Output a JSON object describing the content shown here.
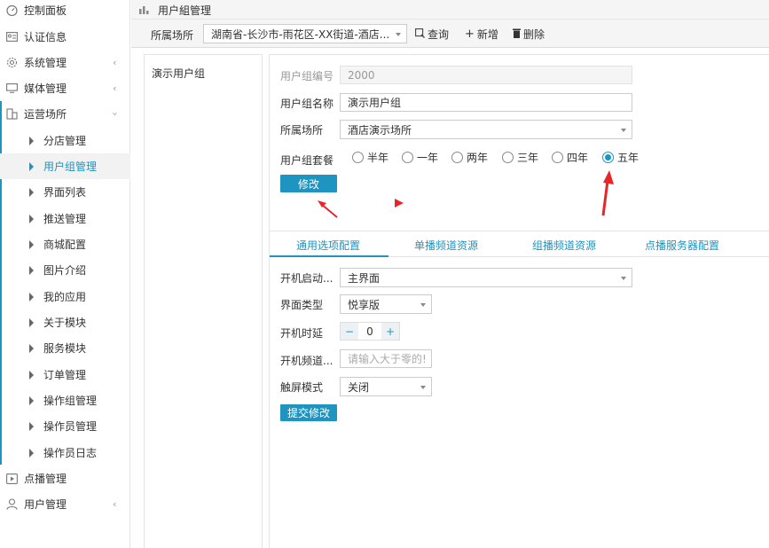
{
  "sidebar": {
    "items": [
      {
        "label": "控制面板",
        "icon": "dashboard-icon"
      },
      {
        "label": "认证信息",
        "icon": "id-card-icon"
      },
      {
        "label": "系统管理",
        "icon": "gear-icon",
        "expandable": true
      },
      {
        "label": "媒体管理",
        "icon": "monitor-icon",
        "expandable": true
      },
      {
        "label": "运营场所",
        "icon": "building-icon",
        "expanded": true
      }
    ],
    "sub_items": [
      {
        "label": "分店管理"
      },
      {
        "label": "用户组管理",
        "active": true
      },
      {
        "label": "界面列表"
      },
      {
        "label": "推送管理"
      },
      {
        "label": "商城配置"
      },
      {
        "label": "图片介绍"
      },
      {
        "label": "我的应用"
      },
      {
        "label": "关于模块"
      },
      {
        "label": "服务模块"
      },
      {
        "label": "订单管理"
      },
      {
        "label": "操作组管理"
      },
      {
        "label": "操作员管理"
      },
      {
        "label": "操作员日志"
      }
    ],
    "bottom_items": [
      {
        "label": "点播管理",
        "icon": "play-icon"
      },
      {
        "label": "用户管理",
        "icon": "user-icon",
        "expandable": true
      }
    ]
  },
  "header": {
    "title": "用户組管理",
    "venue_label": "所属场所",
    "venue_value": "湖南省-长沙市-雨花区-XX街道-酒店...",
    "query_label": "查询",
    "add_label": "新增",
    "delete_label": "删除"
  },
  "group_list": {
    "items": [
      "演示用户组"
    ]
  },
  "form": {
    "id_label": "用户组编号",
    "id_value": "2000",
    "name_label": "用户组名称",
    "name_value": "演示用户组",
    "venue_label": "所属场所",
    "venue_value": "酒店演示场所",
    "package_label": "用户组套餐",
    "package_options": [
      "半年",
      "一年",
      "两年",
      "三年",
      "四年",
      "五年"
    ],
    "package_selected": "五年",
    "submit_label": "修改"
  },
  "tabs": [
    "通用选项配置",
    "单播频道资源",
    "组播频道资源",
    "点播服务器配置"
  ],
  "config": {
    "startup_label": "开机启动...",
    "startup_value": "主界面",
    "ui_type_label": "界面类型",
    "ui_type_value": "悦享版",
    "delay_label": "开机时延",
    "delay_value": "0",
    "minus": "−",
    "plus": "+",
    "channel_label": "开机频道...",
    "channel_placeholder": "请输入大于零的!",
    "touch_label": "触屏模式",
    "touch_value": "关闭",
    "submit_label": "提交修改"
  },
  "colors": {
    "accent": "#1e94c0",
    "annotation": "#e8262a"
  }
}
